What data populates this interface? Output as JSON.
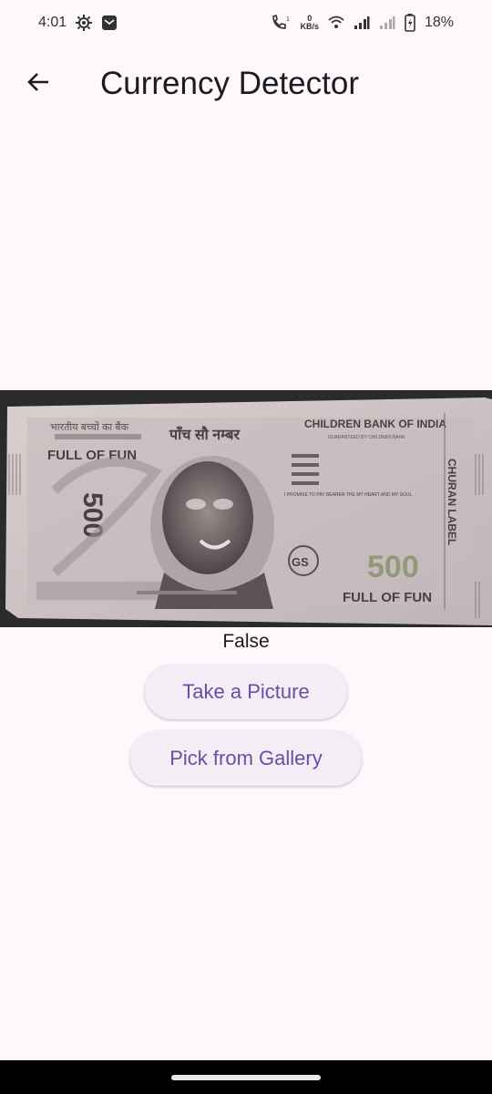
{
  "status_bar": {
    "time": "4:01",
    "net_speed_value": "0",
    "net_speed_unit": "KB/s",
    "battery": "18%",
    "icons": [
      "settings-gear-icon",
      "message-icon",
      "call-volte-icon",
      "wifi-icon",
      "signal-icon",
      "signal-icon-2",
      "battery-icon"
    ]
  },
  "app_bar": {
    "back_icon": "arrow-left-icon",
    "title": "Currency Detector"
  },
  "banknote": {
    "top_left_hindi_1": "भारतीय बच्चों का बैंक",
    "denomination_hindi": "पाँच सौ नम्बर",
    "bank_name": "CHILDREN BANK OF INDIA",
    "guarantee": "GUARANTEED BY CHILDREN BANK",
    "slogan_left": "FULL OF FUN",
    "slogan_right": "FULL OF FUN",
    "value_numeral": "500",
    "value_vertical": "500",
    "side_label": "CHURAN LABEL",
    "emblem": "GS",
    "promise": "I PROMISE TO PAY BEARER THE MY HEART AND MY SOUL"
  },
  "result": {
    "text": "False"
  },
  "actions": {
    "take_picture": "Take a Picture",
    "pick_gallery": "Pick from Gallery"
  }
}
